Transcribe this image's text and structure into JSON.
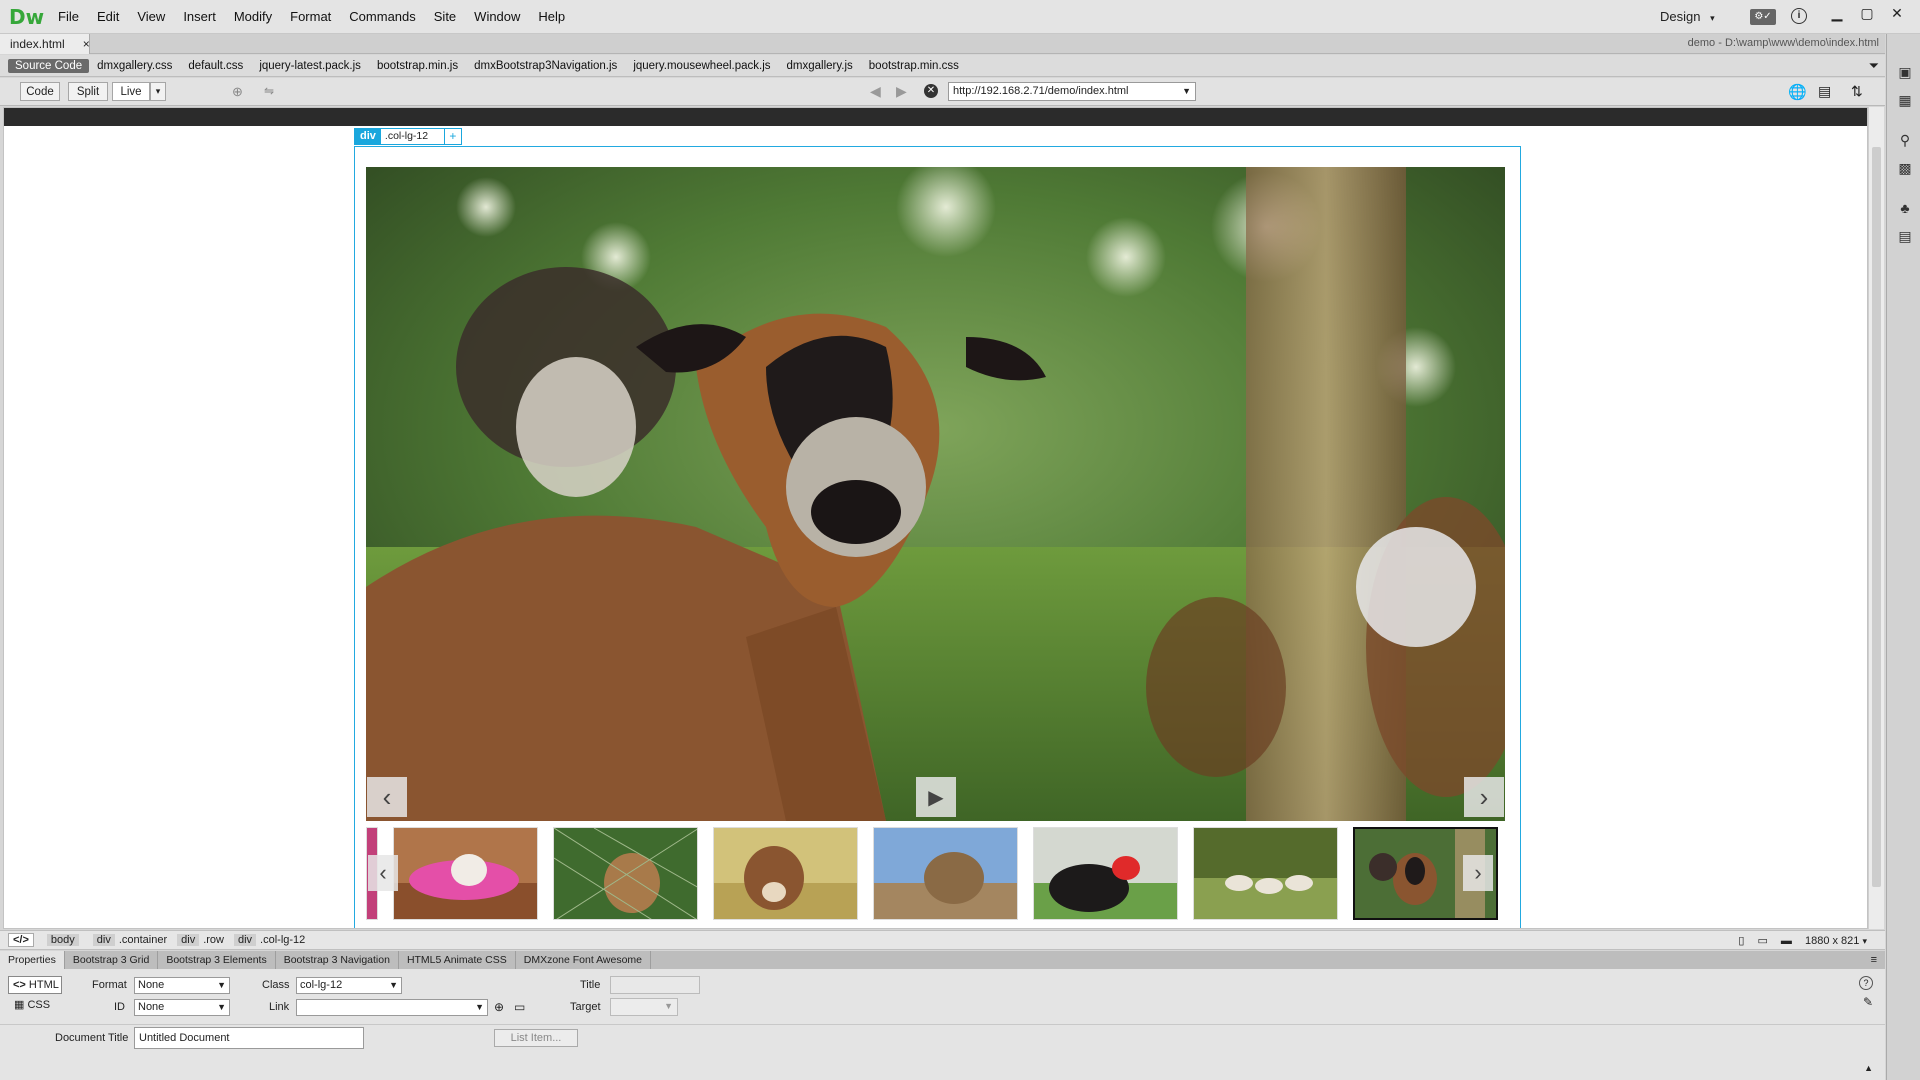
{
  "app": {
    "logo": "Dw",
    "menu": [
      "File",
      "Edit",
      "View",
      "Insert",
      "Modify",
      "Format",
      "Commands",
      "Site",
      "Window",
      "Help"
    ],
    "workspace": "Design"
  },
  "document": {
    "tab_label": "index.html",
    "close_glyph": "×",
    "path": "demo - D:\\wamp\\www\\demo\\index.html"
  },
  "related_files": [
    "Source Code",
    "dmxgallery.css",
    "default.css",
    "jquery-latest.pack.js",
    "bootstrap.min.js",
    "dmxBootstrap3Navigation.js",
    "jquery.mousewheel.pack.js",
    "dmxgallery.js",
    "bootstrap.min.css"
  ],
  "toolbar": {
    "code_label": "Code",
    "split_label": "Split",
    "live_label": "Live",
    "url": "http://192.168.2.71/demo/index.html"
  },
  "selector": {
    "tag": "div",
    "class": ".col-lg-12",
    "add": "+"
  },
  "tag_path": [
    {
      "tag": "body",
      "cls": ""
    },
    {
      "tag": "div",
      "cls": ".container"
    },
    {
      "tag": "div",
      "cls": ".row"
    },
    {
      "tag": "div",
      "cls": ".col-lg-12"
    }
  ],
  "tag_path_prefix": "</>",
  "canvas_size": "1880 x 821",
  "inspector_tabs": [
    "Properties",
    "Bootstrap 3 Grid",
    "Bootstrap 3 Elements",
    "Bootstrap 3 Navigation",
    "HTML5 Animate CSS",
    "DMXzone Font Awesome"
  ],
  "properties": {
    "html_label": "HTML",
    "css_label": "CSS",
    "format_label": "Format",
    "format_value": "None",
    "id_label": "ID",
    "id_value": "None",
    "class_label": "Class",
    "class_value": "col-lg-12",
    "link_label": "Link",
    "link_value": "",
    "title_label": "Title",
    "target_label": "Target",
    "doc_title_label": "Document Title",
    "doc_title_value": "Untitled Document",
    "list_item_label": "List Item..."
  },
  "icons": [
    "close-icon",
    "arrow-left-icon",
    "arrow-right-icon",
    "stop-icon",
    "play-icon",
    "chevron-left-icon",
    "chevron-right-icon",
    "filter-icon",
    "help-icon",
    "edit-icon"
  ],
  "colors": {
    "dw_green": "#36a73a",
    "selection_blue": "#1aa7dd"
  }
}
